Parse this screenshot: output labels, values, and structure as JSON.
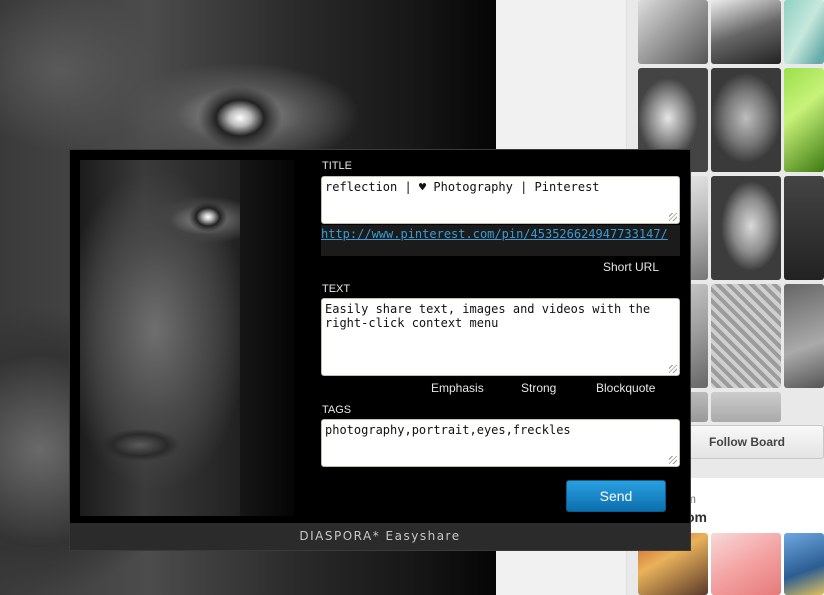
{
  "background": {
    "follow_board_label": "Follow Board",
    "side_text_1": "m",
    "side_text_2": "om"
  },
  "dialog": {
    "title_label": "TITLE",
    "title_value": "reflection | ♥ Photography | Pinterest",
    "url": "http://www.pinterest.com/pin/453526624947733147/",
    "short_url_label": "Short URL",
    "text_label": "TEXT",
    "text_value": "Easily share text, images and videos with the right-click context menu",
    "format_links": [
      "Emphasis",
      "Strong",
      "Blockquote"
    ],
    "tags_label": "TAGS",
    "tags_value": "photography,portrait,eyes,freckles",
    "send_label": "Send",
    "footer": "DIASPORA* Easyshare"
  },
  "colors": {
    "send_button": "#1789cc",
    "url_link": "#3a9bd6",
    "dialog_bg": "#000000",
    "footer_bg": "#2b2b2b"
  }
}
